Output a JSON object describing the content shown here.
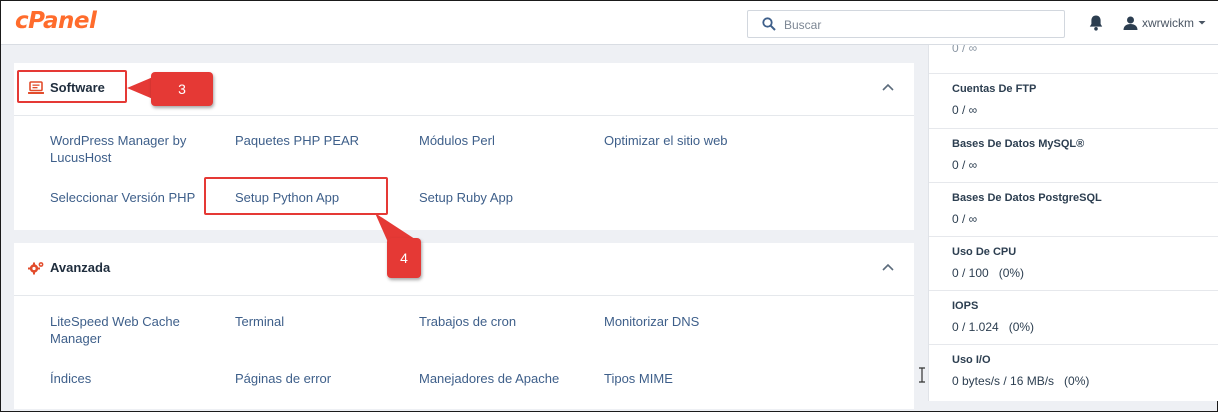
{
  "brand": {
    "logo_text": "cPanel",
    "accent": "#ff6c2c"
  },
  "header": {
    "search_placeholder": "Buscar",
    "username": "xwrwickm"
  },
  "panels": {
    "software": {
      "title": "Software",
      "icon": "laptop-icon",
      "links": [
        "WordPress Manager by LucusHost",
        "Paquetes PHP PEAR",
        "Módulos Perl",
        "Optimizar el sitio web",
        "Seleccionar Versión PHP",
        "Setup Python App",
        "Setup Ruby App"
      ]
    },
    "avanzada": {
      "title": "Avanzada",
      "icon": "gears-icon",
      "links": [
        "LiteSpeed Web Cache Manager",
        "Terminal",
        "Trabajos de cron",
        "Monitorizar DNS",
        "Índices",
        "Páginas de error",
        "Manejadores de Apache",
        "Tipos MIME"
      ]
    }
  },
  "callouts": {
    "step3": "3",
    "step4": "4",
    "color": "#e53935"
  },
  "stats": {
    "partial_top": "0 / ∞",
    "items": [
      {
        "label": "Cuentas De FTP",
        "value": "0 / ∞"
      },
      {
        "label": "Bases De Datos MySQL®",
        "value": "0 / ∞"
      },
      {
        "label": "Bases De Datos PostgreSQL",
        "value": "0 / ∞"
      },
      {
        "label": "Uso De CPU",
        "value": "0 / 100   (0%)"
      },
      {
        "label": "IOPS",
        "value": "0 / 1.024   (0%)"
      },
      {
        "label": "Uso I/O",
        "value": "0 bytes/s / 16 MB/s   (0%)"
      }
    ]
  }
}
